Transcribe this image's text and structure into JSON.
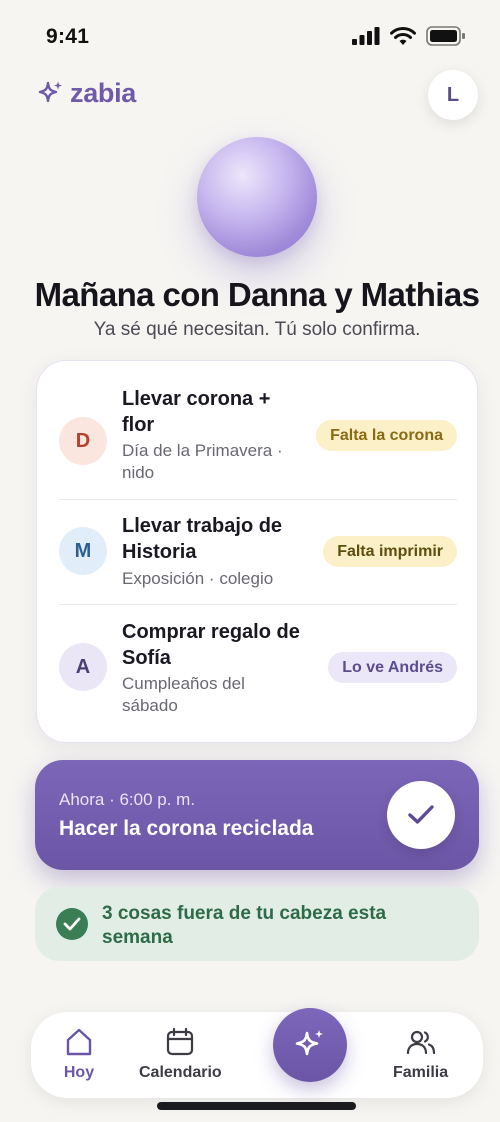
{
  "status_bar": {
    "time": "9:41"
  },
  "header": {
    "app_name": "zabia",
    "avatar_initial": "L"
  },
  "hero": {
    "title": "Mañana con Danna y Mathias",
    "subtitle": "Ya sé qué necesitan. Tú solo confirma."
  },
  "tasks": [
    {
      "initial": "D",
      "title": "Llevar corona + flor",
      "subtitle": "Día de la Primavera · nido",
      "tag": "Falta la corona",
      "initial_color": "#b2402c",
      "initial_bg": "#fbe6df",
      "tag_color": "#8a6a12",
      "tag_bg": "#fbf0c8"
    },
    {
      "initial": "M",
      "title": "Llevar trabajo de Historia",
      "subtitle": "Exposición · colegio",
      "tag": "Falta imprimir",
      "initial_color": "#2d5f8f",
      "initial_bg": "#e1edf8",
      "tag_color": "#5f4d10",
      "tag_bg": "#fbf0c8"
    },
    {
      "initial": "A",
      "title": "Comprar regalo de Sofía",
      "subtitle": "Cumpleaños del sábado",
      "tag": "Lo ve Andrés",
      "initial_color": "#4b3f78",
      "initial_bg": "#ebe6f6",
      "tag_color": "#5a4c8d",
      "tag_bg": "#ece7f8"
    }
  ],
  "now": {
    "time": "Ahora · 6:00 p. m.",
    "task": "Hacer la corona reciclada"
  },
  "summary": {
    "text": "3 cosas fuera de tu cabeza esta semana"
  },
  "nav": {
    "items": [
      {
        "label": "Hoy",
        "icon": "home-icon",
        "active": true
      },
      {
        "label": "Calendario",
        "icon": "calendar-icon",
        "active": false
      },
      {
        "label": "Familia",
        "icon": "family-icon",
        "active": false
      }
    ],
    "fab_icon": "sparkle-icon"
  },
  "colors": {
    "accent": "#6b56a6",
    "success": "#3b7d55",
    "background": "#f6f5f2"
  }
}
